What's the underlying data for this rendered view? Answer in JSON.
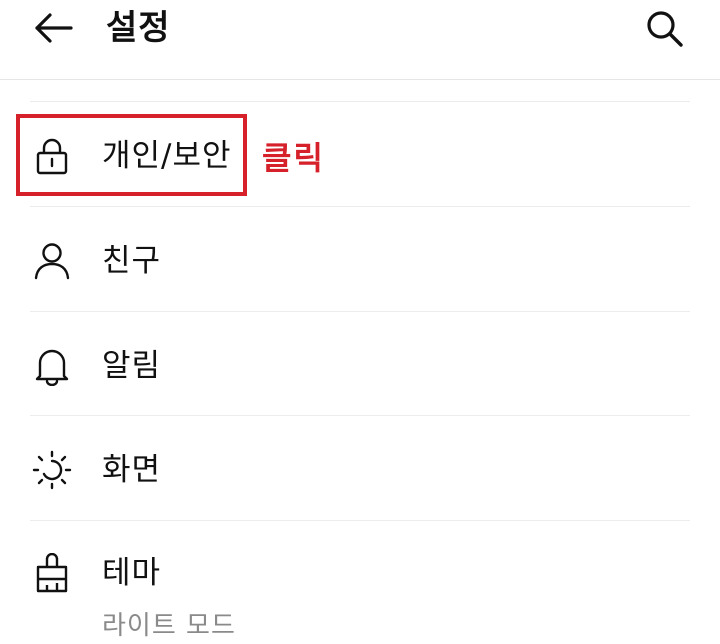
{
  "header": {
    "title": "설정",
    "back_icon": "arrow-left-icon",
    "search_icon": "search-icon"
  },
  "menu": {
    "items": [
      {
        "label": "개인/보안",
        "icon": "lock-icon"
      },
      {
        "label": "친구",
        "icon": "person-icon"
      },
      {
        "label": "알림",
        "icon": "bell-icon"
      },
      {
        "label": "화면",
        "icon": "sun-icon"
      },
      {
        "label": "테마",
        "icon": "brush-icon",
        "sub": "라이트 모드"
      }
    ]
  },
  "annotation": {
    "text": "클릭",
    "color": "#d6202a"
  }
}
